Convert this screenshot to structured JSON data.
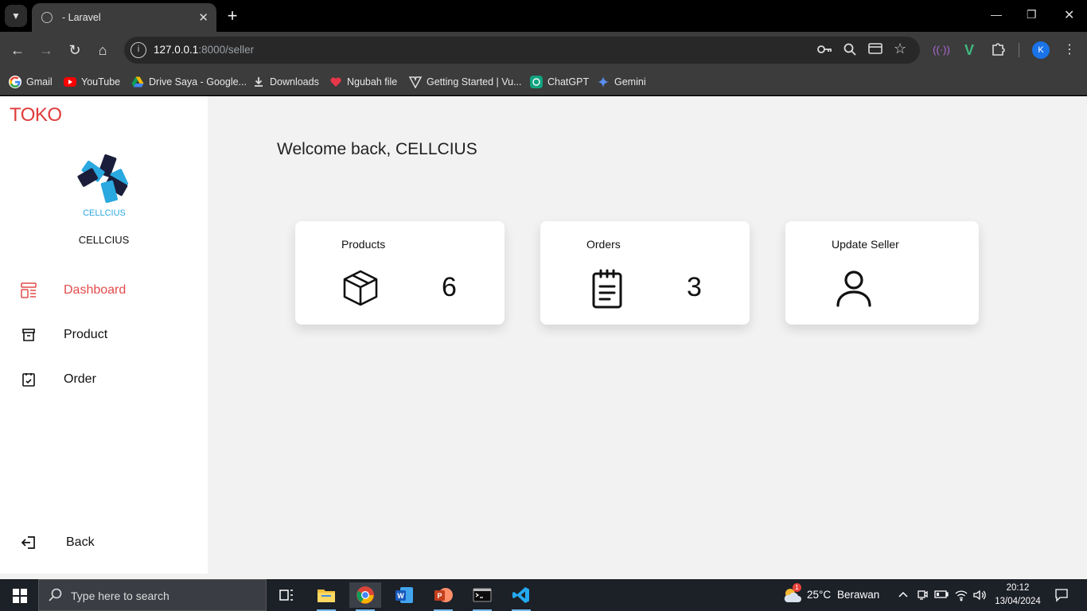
{
  "browser": {
    "tab_title": "- Laravel",
    "new_tab_label": "+",
    "url_host": "127.0.0.1",
    "url_path": ":8000/seller",
    "profile_initial": "K"
  },
  "bookmarks": [
    {
      "label": "Gmail",
      "icon": "gmail-icon"
    },
    {
      "label": "YouTube",
      "icon": "youtube-icon"
    },
    {
      "label": "Drive Saya - Google...",
      "icon": "drive-icon"
    },
    {
      "label": "Downloads",
      "icon": "download-icon"
    },
    {
      "label": "Ngubah file",
      "icon": "heart-icon"
    },
    {
      "label": "Getting Started | Vu...",
      "icon": "vuetify-icon"
    },
    {
      "label": "ChatGPT",
      "icon": "chatgpt-icon"
    },
    {
      "label": "Gemini",
      "icon": "gemini-icon"
    }
  ],
  "sidebar": {
    "brand": "TOKO",
    "store_name": "CELLCIUS",
    "logo_text": "CELLCIUS",
    "items": [
      {
        "label": "Dashboard",
        "icon": "dashboard-icon",
        "active": true
      },
      {
        "label": "Product",
        "icon": "archive-icon",
        "active": false
      },
      {
        "label": "Order",
        "icon": "order-check-icon",
        "active": false
      }
    ],
    "back_label": "Back"
  },
  "main": {
    "welcome": "Welcome back, CELLCIUS",
    "cards": [
      {
        "title": "Products",
        "value": "6",
        "icon": "box-icon"
      },
      {
        "title": "Orders",
        "value": "3",
        "icon": "clipboard-icon"
      },
      {
        "title": "Update Seller",
        "value": "",
        "icon": "user-icon"
      }
    ]
  },
  "taskbar": {
    "search_placeholder": "Type here to search",
    "weather_temp": "25°C",
    "weather_desc": "Berawan",
    "weather_badge": "1",
    "time": "20:12",
    "date": "13/04/2024"
  },
  "colors": {
    "accent": "#e24b4b",
    "brand": "#e03a3a",
    "page_bg": "#f2f2f2",
    "browser_chrome": "#3c3c3c",
    "taskbar": "#1c2027"
  }
}
